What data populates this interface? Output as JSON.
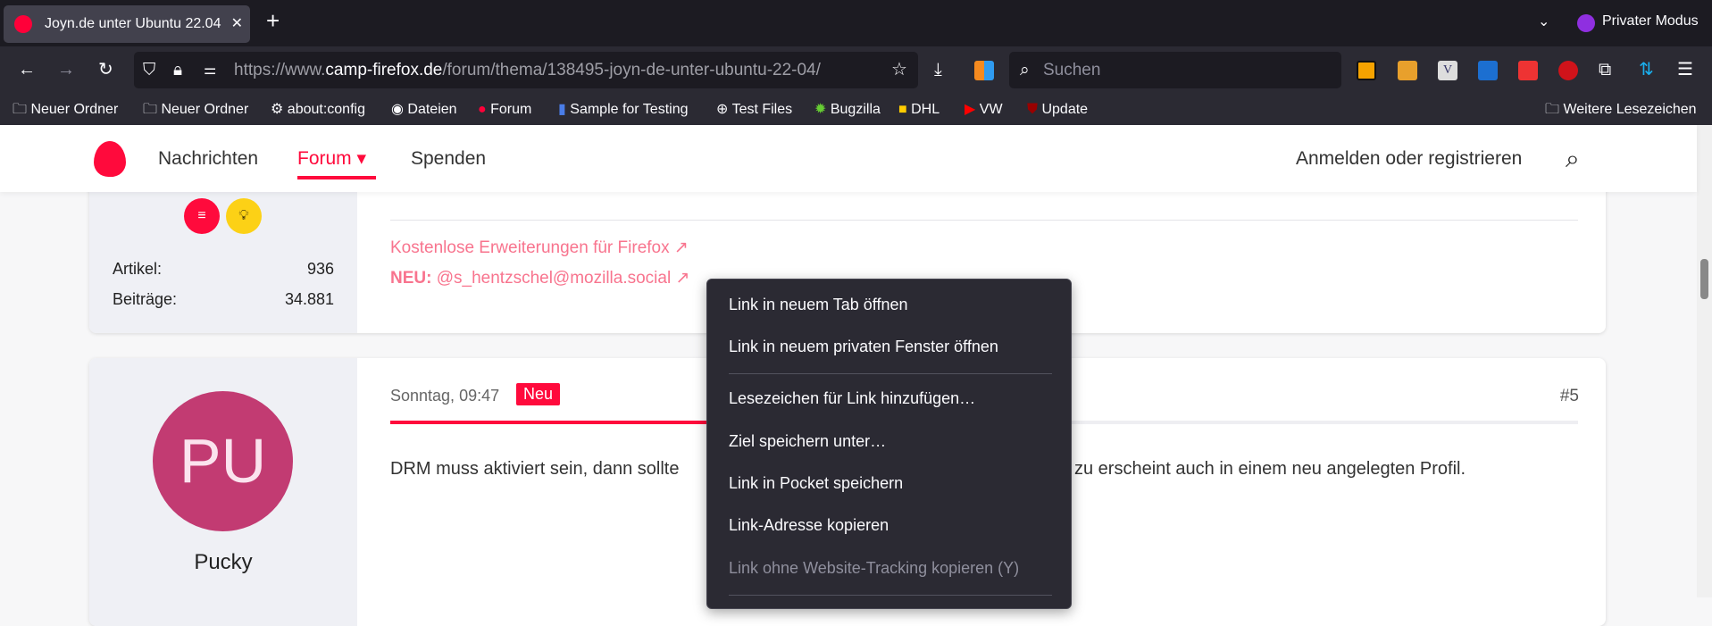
{
  "browser": {
    "tab_title": "Joyn.de unter Ubuntu 22.04",
    "private_label": "Privater Modus",
    "url_prefix": "https://www.",
    "url_domain": "camp-firefox.de",
    "url_path": "/forum/thema/138495-joyn-de-unter-ubuntu-22-04/",
    "search_placeholder": "Suchen",
    "bookmarks": [
      "Neuer Ordner",
      "Neuer Ordner",
      "about:config",
      "Dateien",
      "Forum",
      "Sample for Testing",
      "Test Files",
      "Bugzilla",
      "DHL",
      "VW",
      "Update"
    ],
    "other_bookmarks": "Weitere Lesezeichen"
  },
  "site": {
    "nav": [
      "Nachrichten",
      "Forum",
      "Spenden"
    ],
    "login": "Anmelden oder registrieren"
  },
  "post1": {
    "stats": [
      {
        "label": "Artikel:",
        "value": "936"
      },
      {
        "label": "Beiträge:",
        "value": "34.881"
      }
    ],
    "sig_link": "Kostenlose Erweiterungen für Firefox ↗",
    "sig_new_label": "NEU:",
    "sig_new_link": "@s_hentzschel@mozilla.social ↗"
  },
  "post2": {
    "avatar_initials": "PU",
    "author": "Pucky",
    "date": "Sonntag, 09:47",
    "badge": "Neu",
    "number": "#5",
    "body_part1": "DRM muss aktiviert sein, dann sollte",
    "body_part2": "zu erscheint auch in einem neu angelegten Profil."
  },
  "context_menu": {
    "items": [
      "Link in neuem Tab öffnen",
      "Link in neuem privaten Fenster öffnen",
      "Lesezeichen für Link hinzufügen…",
      "Ziel speichern unter…",
      "Link in Pocket speichern",
      "Link-Adresse kopieren",
      "Link ohne Website-Tracking kopieren (Y)"
    ]
  },
  "colors": {
    "accent": "#ff0a3c",
    "avatar": "#c23b72"
  }
}
